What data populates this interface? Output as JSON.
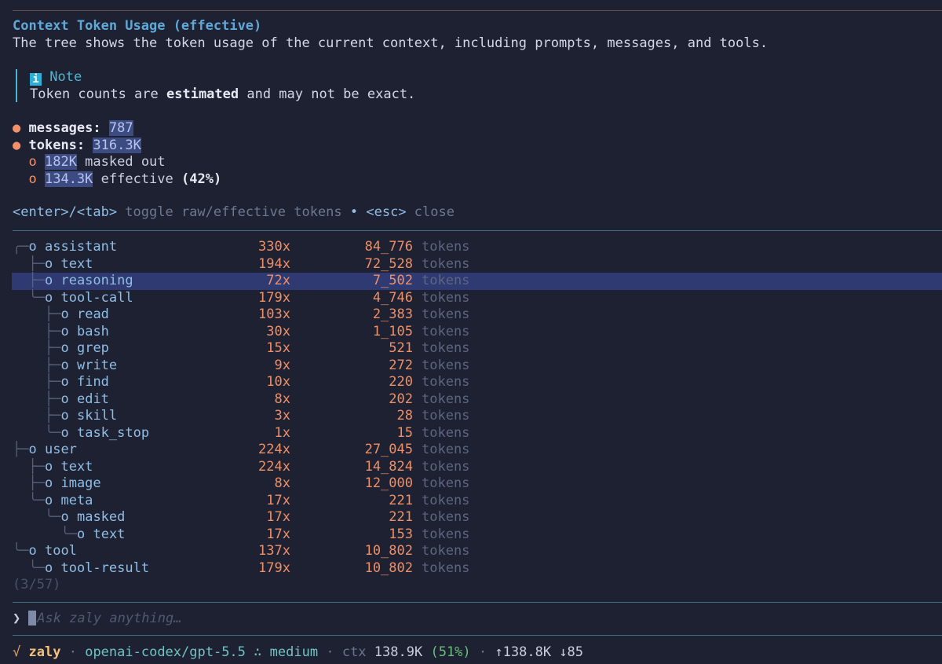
{
  "header": {
    "title": "Context Token Usage (effective)",
    "description": "The tree shows the token usage of the current context, including prompts, messages, and tools."
  },
  "note": {
    "icon": "info-icon",
    "label": "Note",
    "text_before": "Token counts are ",
    "text_bold": "estimated",
    "text_after": " and may not be exact."
  },
  "summary": {
    "messages_label": "messages:",
    "messages_value": "787",
    "tokens_label": "tokens:",
    "tokens_value": "316.3K",
    "masked_value": "182K",
    "masked_label": " masked out",
    "effective_value": "134.3K",
    "effective_label": " effective ",
    "effective_pct": "(42%)"
  },
  "hint": {
    "key1": "<enter>/<tab>",
    "text1": " toggle raw/effective tokens ",
    "sep": "•",
    "key2": "<esc>",
    "text2": " close"
  },
  "tree": {
    "selected_index": 2,
    "unit": "tokens",
    "rows": [
      {
        "depth": 0,
        "conn": "╭─",
        "label": "assistant",
        "count": "330x",
        "tokens": "84_776"
      },
      {
        "depth": 1,
        "conn": "├─",
        "label": "text",
        "count": "194x",
        "tokens": "72_528"
      },
      {
        "depth": 1,
        "conn": "├─",
        "label": "reasoning",
        "count": "72x",
        "tokens": "7_502"
      },
      {
        "depth": 1,
        "conn": "╰─",
        "label": "tool-call",
        "count": "179x",
        "tokens": "4_746"
      },
      {
        "depth": 2,
        "conn": "├─",
        "label": "read",
        "count": "103x",
        "tokens": "2_383"
      },
      {
        "depth": 2,
        "conn": "├─",
        "label": "bash",
        "count": "30x",
        "tokens": "1_105"
      },
      {
        "depth": 2,
        "conn": "├─",
        "label": "grep",
        "count": "15x",
        "tokens": "521"
      },
      {
        "depth": 2,
        "conn": "├─",
        "label": "write",
        "count": "9x",
        "tokens": "272"
      },
      {
        "depth": 2,
        "conn": "├─",
        "label": "find",
        "count": "10x",
        "tokens": "220"
      },
      {
        "depth": 2,
        "conn": "├─",
        "label": "edit",
        "count": "8x",
        "tokens": "202"
      },
      {
        "depth": 2,
        "conn": "├─",
        "label": "skill",
        "count": "3x",
        "tokens": "28"
      },
      {
        "depth": 2,
        "conn": "╰─",
        "label": "task_stop",
        "count": "1x",
        "tokens": "15"
      },
      {
        "depth": 0,
        "conn": "├─",
        "label": "user",
        "count": "224x",
        "tokens": "27_045"
      },
      {
        "depth": 1,
        "conn": "├─",
        "label": "text",
        "count": "224x",
        "tokens": "14_824"
      },
      {
        "depth": 1,
        "conn": "├─",
        "label": "image",
        "count": "8x",
        "tokens": "12_000"
      },
      {
        "depth": 1,
        "conn": "╰─",
        "label": "meta",
        "count": "17x",
        "tokens": "221"
      },
      {
        "depth": 2,
        "conn": "╰─",
        "label": "masked",
        "count": "17x",
        "tokens": "221"
      },
      {
        "depth": 3,
        "conn": "╰─",
        "label": "text",
        "count": "17x",
        "tokens": "153"
      },
      {
        "depth": 0,
        "conn": "╰─",
        "label": "tool",
        "count": "137x",
        "tokens": "10_802"
      },
      {
        "depth": 1,
        "conn": "╰─",
        "label": "tool-result",
        "count": "179x",
        "tokens": "10_802"
      }
    ],
    "pager": "(3/57)"
  },
  "prompt": {
    "glyph": "❯",
    "placeholder": "Ask zaly anything…"
  },
  "status": {
    "check": "√",
    "name": "zaly",
    "sep": "·",
    "model": "openai-codex/gpt-5.5",
    "effort_glyph": "∴",
    "effort": "medium",
    "ctx_label": "ctx",
    "ctx_value": "138.9K",
    "ctx_pct": "(51%)",
    "up": "↑138.8K",
    "down": "↓85"
  },
  "colors": {
    "background": "#1e2131",
    "accent": "#5fa9d8",
    "number": "#ef8f66",
    "selection": "#2f3a73",
    "highlight": "#3c4c83"
  }
}
